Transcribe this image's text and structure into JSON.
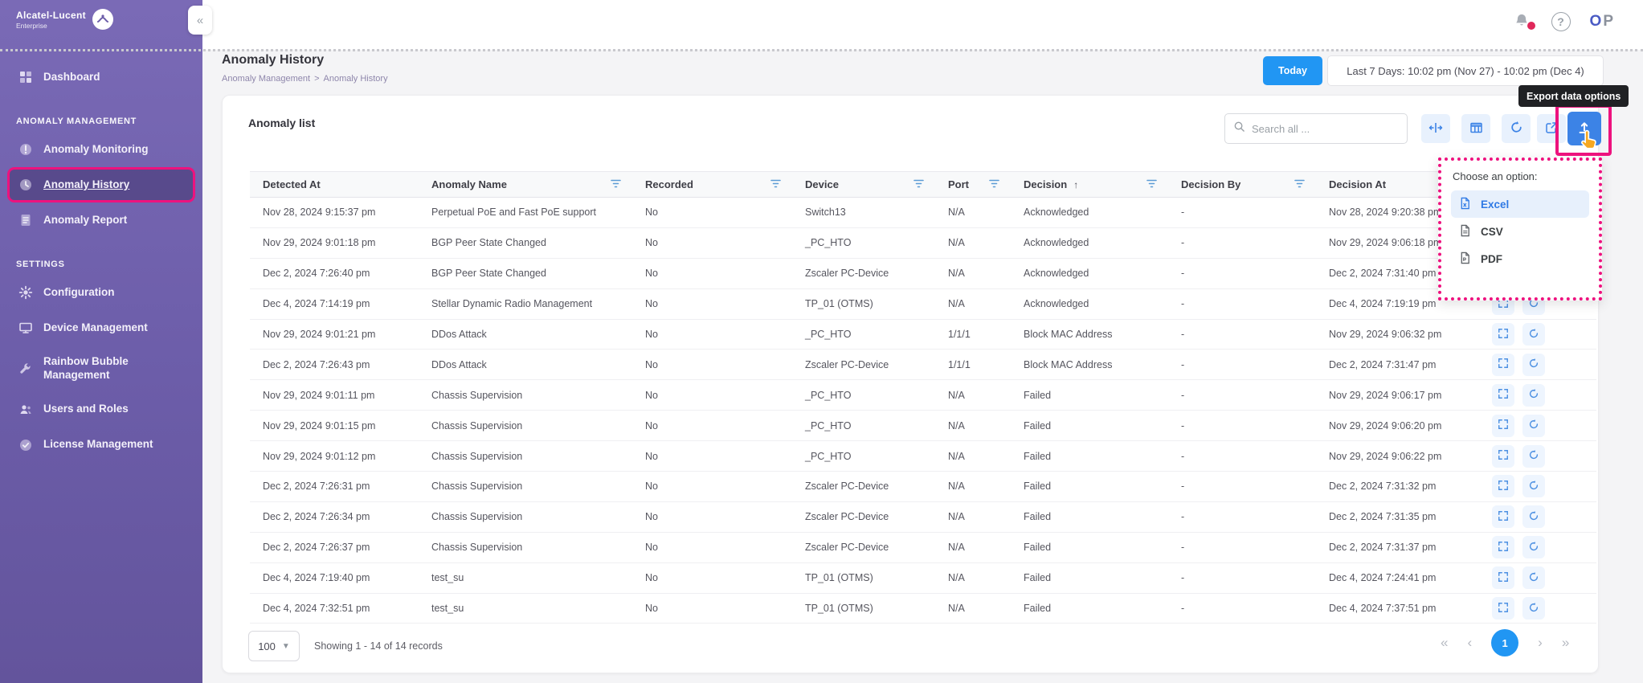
{
  "brand": {
    "title": "Alcatel-Lucent",
    "subtitle": "Enterprise"
  },
  "topbar": {
    "collapse_glyph": "«",
    "help_glyph": "?",
    "initial_primary": "O",
    "initial_secondary": "P"
  },
  "sidebar": {
    "groups": [
      {
        "items": [
          {
            "label": "Dashboard"
          }
        ]
      },
      {
        "header": "ANOMALY MANAGEMENT",
        "items": [
          {
            "label": "Anomaly Monitoring"
          },
          {
            "label": "Anomaly History",
            "active": true
          },
          {
            "label": "Anomaly Report"
          }
        ]
      },
      {
        "header": "SETTINGS",
        "items": [
          {
            "label": "Configuration"
          },
          {
            "label": "Device Management"
          },
          {
            "label": "Rainbow Bubble Management"
          },
          {
            "label": "Users and Roles"
          },
          {
            "label": "License Management"
          }
        ]
      }
    ]
  },
  "page_header": {
    "title": "Anomaly History",
    "breadcrumb_parent": "Anomaly Management",
    "breadcrumb_separator": ">",
    "breadcrumb_current": "Anomaly History",
    "today_label": "Today",
    "date_range": "Last 7 Days: 10:02 pm (Nov 27) - 10:02 pm (Dec 4)"
  },
  "tooltip": {
    "text": "Export data options"
  },
  "export_menu": {
    "title": "Choose an option:",
    "options": [
      {
        "label": "Excel",
        "selected": true
      },
      {
        "label": "CSV",
        "selected": false
      },
      {
        "label": "PDF",
        "selected": false
      }
    ]
  },
  "card": {
    "title": "Anomaly list",
    "search_placeholder": "Search all ..."
  },
  "table": {
    "columns": [
      {
        "label": "Detected At",
        "filter": false
      },
      {
        "label": "Anomaly Name",
        "filter": true
      },
      {
        "label": "Recorded",
        "filter": true
      },
      {
        "label": "Device",
        "filter": true
      },
      {
        "label": "Port",
        "filter": true
      },
      {
        "label": "Decision",
        "filter": true,
        "sort": "↑"
      },
      {
        "label": "Decision By",
        "filter": true
      },
      {
        "label": "Decision At",
        "filter": false
      }
    ],
    "rows": [
      {
        "detected_at": "Nov 28, 2024 9:15:37 pm",
        "anomaly_name": "Perpetual PoE and Fast PoE support",
        "recorded": "No",
        "device": "Switch13",
        "port": "N/A",
        "decision": "Acknowledged",
        "decision_by": "-",
        "decision_at": "Nov 28, 2024 9:20:38 pm"
      },
      {
        "detected_at": "Nov 29, 2024 9:01:18 pm",
        "anomaly_name": "BGP Peer State Changed",
        "recorded": "No",
        "device": "_PC_HTO",
        "port": "N/A",
        "decision": "Acknowledged",
        "decision_by": "-",
        "decision_at": "Nov 29, 2024 9:06:18 pm"
      },
      {
        "detected_at": "Dec 2, 2024 7:26:40 pm",
        "anomaly_name": "BGP Peer State Changed",
        "recorded": "No",
        "device": "Zscaler PC-Device",
        "port": "N/A",
        "decision": "Acknowledged",
        "decision_by": "-",
        "decision_at": "Dec 2, 2024 7:31:40 pm"
      },
      {
        "detected_at": "Dec 4, 2024 7:14:19 pm",
        "anomaly_name": "Stellar Dynamic Radio Management",
        "recorded": "No",
        "device": "TP_01 (OTMS)",
        "port": "N/A",
        "decision": "Acknowledged",
        "decision_by": "-",
        "decision_at": "Dec 4, 2024 7:19:19 pm"
      },
      {
        "detected_at": "Nov 29, 2024 9:01:21 pm",
        "anomaly_name": "DDos Attack",
        "recorded": "No",
        "device": "_PC_HTO",
        "port": "1/1/1",
        "decision": "Block MAC Address",
        "decision_by": "-",
        "decision_at": "Nov 29, 2024 9:06:32 pm"
      },
      {
        "detected_at": "Dec 2, 2024 7:26:43 pm",
        "anomaly_name": "DDos Attack",
        "recorded": "No",
        "device": "Zscaler PC-Device",
        "port": "1/1/1",
        "decision": "Block MAC Address",
        "decision_by": "-",
        "decision_at": "Dec 2, 2024 7:31:47 pm"
      },
      {
        "detected_at": "Nov 29, 2024 9:01:11 pm",
        "anomaly_name": "Chassis Supervision",
        "recorded": "No",
        "device": "_PC_HTO",
        "port": "N/A",
        "decision": "Failed",
        "decision_by": "-",
        "decision_at": "Nov 29, 2024 9:06:17 pm"
      },
      {
        "detected_at": "Nov 29, 2024 9:01:15 pm",
        "anomaly_name": "Chassis Supervision",
        "recorded": "No",
        "device": "_PC_HTO",
        "port": "N/A",
        "decision": "Failed",
        "decision_by": "-",
        "decision_at": "Nov 29, 2024 9:06:20 pm"
      },
      {
        "detected_at": "Nov 29, 2024 9:01:12 pm",
        "anomaly_name": "Chassis Supervision",
        "recorded": "No",
        "device": "_PC_HTO",
        "port": "N/A",
        "decision": "Failed",
        "decision_by": "-",
        "decision_at": "Nov 29, 2024 9:06:22 pm"
      },
      {
        "detected_at": "Dec 2, 2024 7:26:31 pm",
        "anomaly_name": "Chassis Supervision",
        "recorded": "No",
        "device": "Zscaler PC-Device",
        "port": "N/A",
        "decision": "Failed",
        "decision_by": "-",
        "decision_at": "Dec 2, 2024 7:31:32 pm"
      },
      {
        "detected_at": "Dec 2, 2024 7:26:34 pm",
        "anomaly_name": "Chassis Supervision",
        "recorded": "No",
        "device": "Zscaler PC-Device",
        "port": "N/A",
        "decision": "Failed",
        "decision_by": "-",
        "decision_at": "Dec 2, 2024 7:31:35 pm"
      },
      {
        "detected_at": "Dec 2, 2024 7:26:37 pm",
        "anomaly_name": "Chassis Supervision",
        "recorded": "No",
        "device": "Zscaler PC-Device",
        "port": "N/A",
        "decision": "Failed",
        "decision_by": "-",
        "decision_at": "Dec 2, 2024 7:31:37 pm"
      },
      {
        "detected_at": "Dec 4, 2024 7:19:40 pm",
        "anomaly_name": "test_su",
        "recorded": "No",
        "device": "TP_01 (OTMS)",
        "port": "N/A",
        "decision": "Failed",
        "decision_by": "-",
        "decision_at": "Dec 4, 2024 7:24:41 pm"
      },
      {
        "detected_at": "Dec 4, 2024 7:32:51 pm",
        "anomaly_name": "test_su",
        "recorded": "No",
        "device": "TP_01 (OTMS)",
        "port": "N/A",
        "decision": "Failed",
        "decision_by": "-",
        "decision_at": "Dec 4, 2024 7:37:51 pm"
      }
    ]
  },
  "footer": {
    "page_size": "100",
    "showing_text": "Showing 1 - 14 of 14 records",
    "pagination": {
      "first": "«",
      "prev": "‹",
      "page": "1",
      "next": "›",
      "last": "»"
    }
  },
  "colors": {
    "accent_blue": "#2196f3",
    "export_blue": "#3c83e6",
    "annotation_pink": "#ed127e",
    "sidebar_purple": "#6c5da9",
    "notification_red": "#e0285a"
  }
}
